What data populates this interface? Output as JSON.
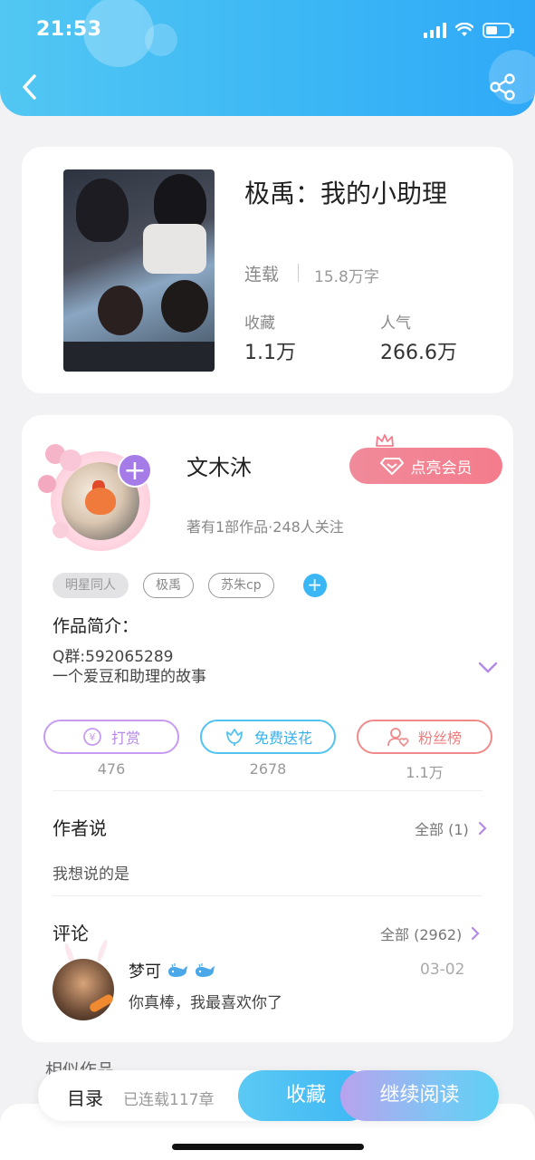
{
  "status_bar": {
    "time": "21:53"
  },
  "book": {
    "title": "极禹：我的小助理",
    "status": "连载",
    "words": "15.8万字",
    "favorites_label": "收藏",
    "favorites_value": "1.1万",
    "popularity_label": "人气",
    "popularity_value": "266.6万"
  },
  "author": {
    "name": "文木沐",
    "meta": "著有1部作品·248人关注",
    "vip_label": "点亮会员",
    "tags": [
      "明星同人",
      "极禹",
      "苏朱cp"
    ],
    "intro_label": "作品简介：",
    "intro_text": "Q群:592065289\n一个爱豆和助理的故事"
  },
  "actions": [
    {
      "label": "打赏",
      "count": "476",
      "color": "#c79cf0"
    },
    {
      "label": "免费送花",
      "count": "2678",
      "color": "#52c3f0"
    },
    {
      "label": "粉丝榜",
      "count": "1.1万",
      "color": "#f08a8a"
    }
  ],
  "author_says": {
    "title": "作者说",
    "link": "全部 (1)",
    "text": "我想说的是"
  },
  "comments": {
    "title": "评论",
    "link": "全部 (2962)",
    "items": [
      {
        "name": "梦可",
        "date": "03-02",
        "text": "你真棒，我最喜欢你了"
      }
    ]
  },
  "similar_title": "相似作品",
  "bottom_bar": {
    "toc_label": "目录",
    "chapters": "已连载117章",
    "favorite_label": "收藏",
    "read_label": "继续阅读"
  },
  "colors": {
    "accent": "#3bb6f5",
    "vip": "#f47c8c",
    "purple": "#a57be8"
  }
}
